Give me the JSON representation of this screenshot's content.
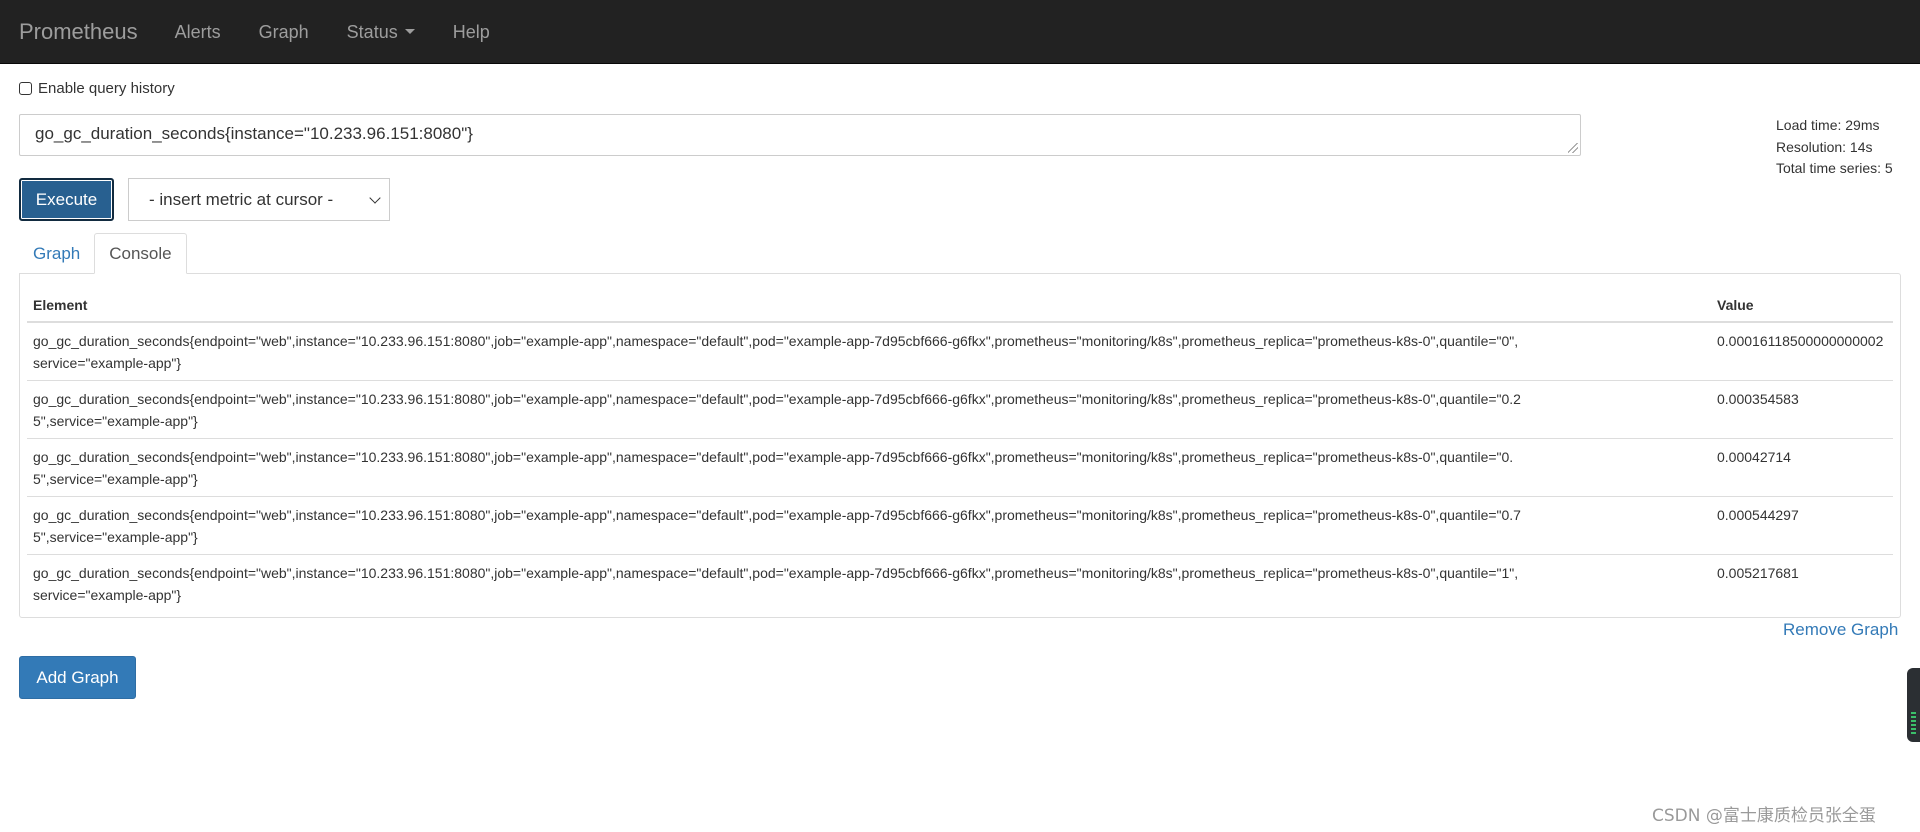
{
  "navbar": {
    "brand": "Prometheus",
    "links": [
      {
        "label": "Alerts"
      },
      {
        "label": "Graph"
      },
      {
        "label": "Status"
      },
      {
        "label": "Help"
      }
    ]
  },
  "query_history": {
    "label": "Enable query history",
    "checked": false
  },
  "expression": {
    "value": "go_gc_duration_seconds{instance=\"10.233.96.151:8080\"}"
  },
  "stats": {
    "load_time": "Load time: 29ms",
    "resolution": "Resolution: 14s",
    "total_series": "Total time series: 5"
  },
  "buttons": {
    "execute": "Execute",
    "add_graph": "Add Graph",
    "remove_graph": "Remove Graph"
  },
  "metric_select": {
    "selected": "- insert metric at cursor -"
  },
  "tabs": [
    {
      "label": "Graph",
      "active": false
    },
    {
      "label": "Console",
      "active": true
    }
  ],
  "table": {
    "headers": {
      "element": "Element",
      "value": "Value"
    },
    "rows": [
      {
        "element": "go_gc_duration_seconds{endpoint=\"web\",instance=\"10.233.96.151:8080\",job=\"example-app\",namespace=\"default\",pod=\"example-app-7d95cbf666-g6fkx\",prometheus=\"monitoring/k8s\",prometheus_replica=\"prometheus-k8s-0\",quantile=\"0\",service=\"example-app\"}",
        "value": "0.00016118500000000002"
      },
      {
        "element": "go_gc_duration_seconds{endpoint=\"web\",instance=\"10.233.96.151:8080\",job=\"example-app\",namespace=\"default\",pod=\"example-app-7d95cbf666-g6fkx\",prometheus=\"monitoring/k8s\",prometheus_replica=\"prometheus-k8s-0\",quantile=\"0.25\",service=\"example-app\"}",
        "value": "0.000354583"
      },
      {
        "element": "go_gc_duration_seconds{endpoint=\"web\",instance=\"10.233.96.151:8080\",job=\"example-app\",namespace=\"default\",pod=\"example-app-7d95cbf666-g6fkx\",prometheus=\"monitoring/k8s\",prometheus_replica=\"prometheus-k8s-0\",quantile=\"0.5\",service=\"example-app\"}",
        "value": "0.00042714"
      },
      {
        "element": "go_gc_duration_seconds{endpoint=\"web\",instance=\"10.233.96.151:8080\",job=\"example-app\",namespace=\"default\",pod=\"example-app-7d95cbf666-g6fkx\",prometheus=\"monitoring/k8s\",prometheus_replica=\"prometheus-k8s-0\",quantile=\"0.75\",service=\"example-app\"}",
        "value": "0.000544297"
      },
      {
        "element": "go_gc_duration_seconds{endpoint=\"web\",instance=\"10.233.96.151:8080\",job=\"example-app\",namespace=\"default\",pod=\"example-app-7d95cbf666-g6fkx\",prometheus=\"monitoring/k8s\",prometheus_replica=\"prometheus-k8s-0\",quantile=\"1\",service=\"example-app\"}",
        "value": "0.005217681"
      }
    ]
  },
  "watermark": "CSDN @富士康质检员张全蛋",
  "colors": {
    "navbar_bg": "#222222",
    "nav_text": "#9d9d9d",
    "primary": "#337ab7",
    "primary_dark": "#286090",
    "border": "#dddddd"
  }
}
